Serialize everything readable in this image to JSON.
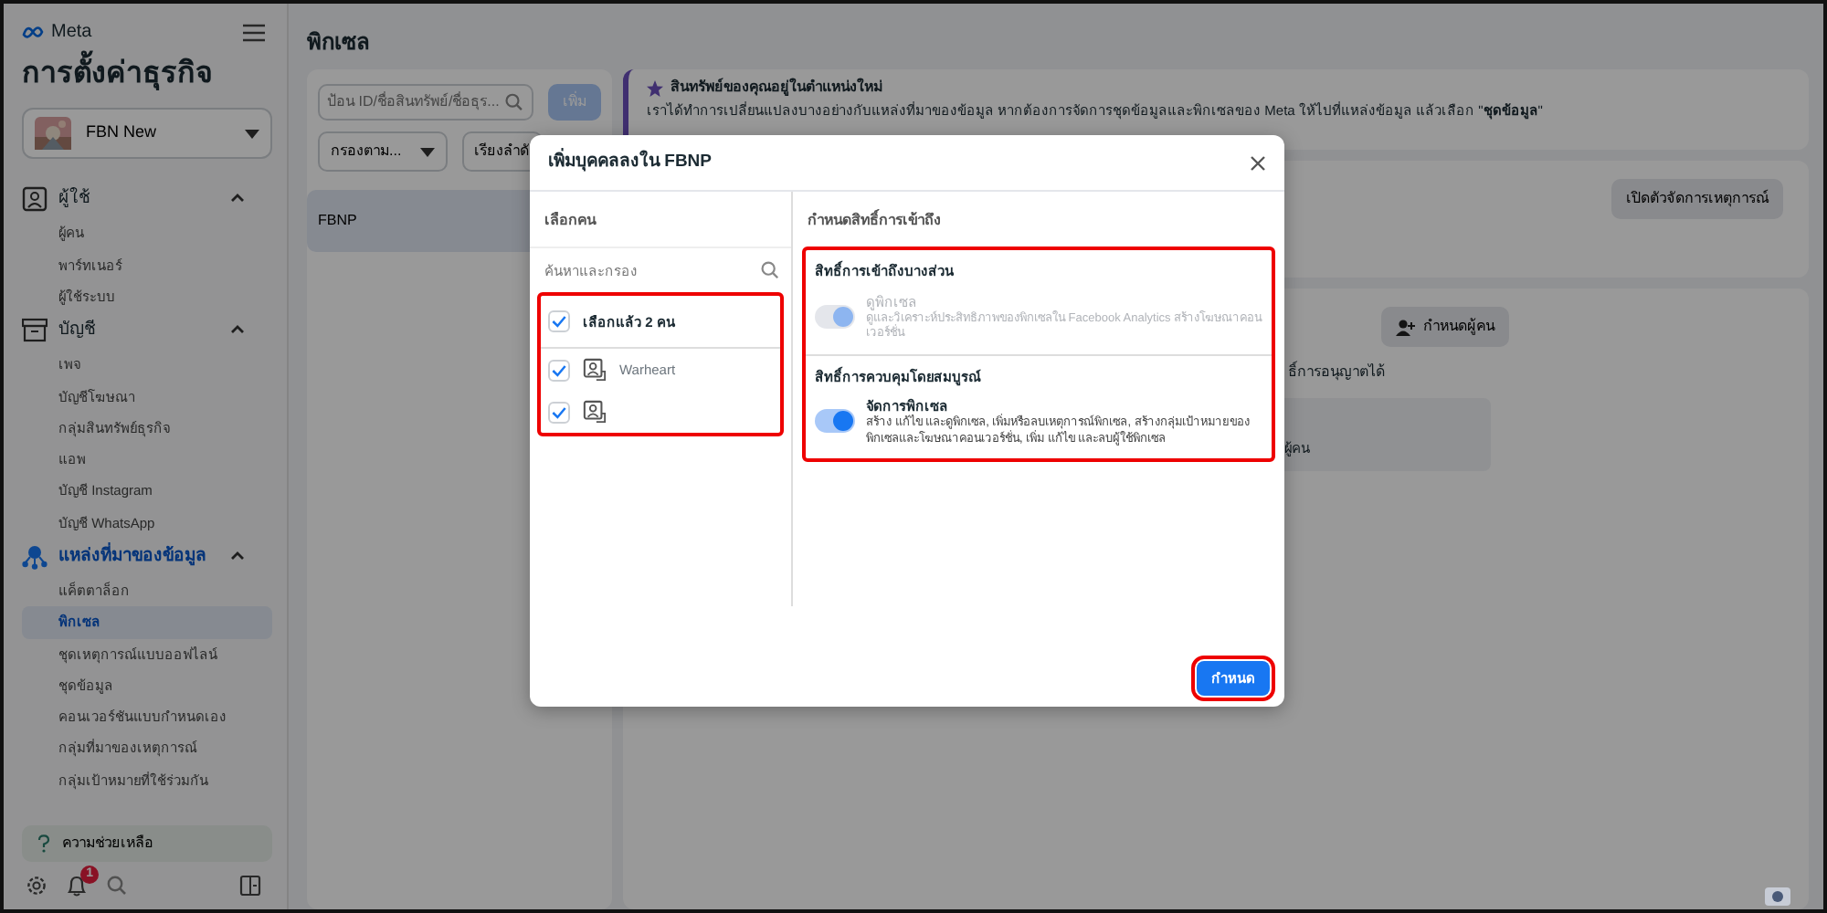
{
  "sidebar": {
    "brand": "Meta",
    "title": "การตั้งค่าธุรกิจ",
    "account": {
      "name": "FBN New"
    },
    "sections": [
      {
        "label": "ผู้ใช้",
        "kind": "people",
        "expanded": true,
        "active": false,
        "items": [
          {
            "label": "ผู้คน",
            "selected": false
          },
          {
            "label": "พาร์ทเนอร์",
            "selected": false
          },
          {
            "label": "ผู้ใช้ระบบ",
            "selected": false
          }
        ]
      },
      {
        "label": "บัญชี",
        "kind": "accounts",
        "expanded": true,
        "active": false,
        "items": [
          {
            "label": "เพจ",
            "selected": false
          },
          {
            "label": "บัญชีโฆษณา",
            "selected": false
          },
          {
            "label": "กลุ่มสินทรัพย์ธุรกิจ",
            "selected": false
          },
          {
            "label": "แอพ",
            "selected": false
          },
          {
            "label": "บัญชี Instagram",
            "selected": false
          },
          {
            "label": "บัญชี WhatsApp",
            "selected": false
          }
        ]
      },
      {
        "label": "แหล่งที่มาของข้อมูล",
        "kind": "data",
        "expanded": true,
        "active": true,
        "items": [
          {
            "label": "แค็ตตาล็อก",
            "selected": false
          },
          {
            "label": "พิกเซล",
            "selected": true
          },
          {
            "label": "ชุดเหตุการณ์แบบออฟไลน์",
            "selected": false
          },
          {
            "label": "ชุดข้อมูล",
            "selected": false
          },
          {
            "label": "คอนเวอร์ชันแบบกำหนดเอง",
            "selected": false
          },
          {
            "label": "กลุ่มที่มาของเหตุการณ์",
            "selected": false
          },
          {
            "label": "กลุ่มเป้าหมายที่ใช้ร่วมกัน",
            "selected": false
          }
        ]
      }
    ],
    "help": "ความช่วยเหลือ",
    "notification_count": "1"
  },
  "header": {
    "title": "พิกเซล"
  },
  "asset_list": {
    "search_placeholder": "ป้อน ID/ชื่อสินทรัพย์/ชื่อธุร...",
    "add_button": "เพิ่ม",
    "filter": "กรองตาม...",
    "sort": "เรียงลำดั",
    "items": [
      {
        "label": "FBNP",
        "selected": true
      }
    ]
  },
  "notice": {
    "title": "สินทรัพย์ของคุณอยู่ในตำแหน่งใหม่",
    "text": "เราได้ทำการเปลี่ยนแปลงบางอย่างกับแหล่งที่มาของข้อมูล หากต้องการจัดการชุดข้อมูลและพิกเซลของ Meta ให้ไปที่แหล่งข้อมูล แล้วเลือก \"**ชุดข้อมูล**\""
  },
  "detail": {
    "event_manager_button": "เปิดตัวจัดการเหตุการณ์",
    "assign_button": "กำหนดผู้คน",
    "permissions_text": "ธิ์การอนุญาตได้",
    "people_label": "ผู้คน"
  },
  "dialog": {
    "title": "เพิ่มบุคคลลงใน FBNP",
    "people_header": "เลือกคน",
    "search_placeholder": "ค้นหาและกรอง",
    "people_highlighted": true,
    "selected_summary": {
      "label": "เลือกแล้ว 2 คน",
      "checked": true
    },
    "people": [
      {
        "name": "Warheart",
        "checked": true
      },
      {
        "checked": true
      }
    ],
    "permissions_header": "กำหนดสิทธิ์การเข้าถึง",
    "permissions_highlighted": true,
    "permissions": [
      {
        "title": "สิทธิ์การเข้าถึงบางส่วน",
        "label": "ดูพิกเซล",
        "description": "ดูและวิเคราะห์ประสิทธิภาพของพิกเซลใน Facebook Analytics สร้างโฆษณาคอนเวอร์ชั่น",
        "on": true,
        "disabled": true
      },
      {
        "title": "สิทธิ์การควบคุมโดยสมบูรณ์",
        "label": "จัดการพิกเซล",
        "description": "สร้าง แก้ไข และดูพิกเซล, เพิ่มหรือลบเหตุการณ์พิกเซล, สร้างกลุ่มเป้าหมายของพิกเซลและโฆษณาคอนเวอร์ชั่น, เพิ่ม แก้ไข และลบผู้ใช้พิกเซล",
        "on": true,
        "disabled": false
      }
    ],
    "submit_button": "กำหนด",
    "submit_highlighted": true
  }
}
